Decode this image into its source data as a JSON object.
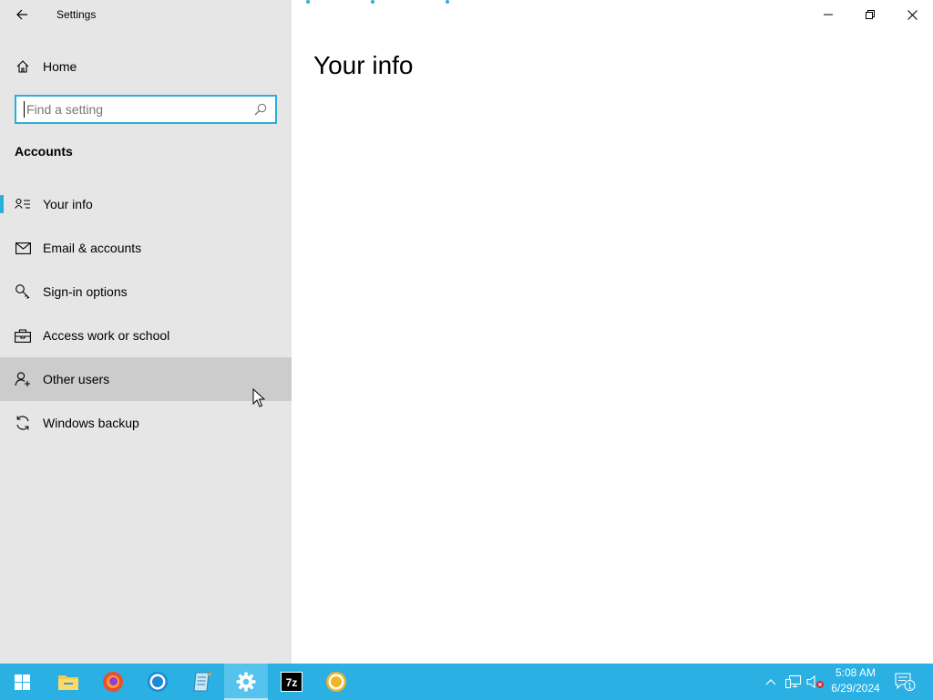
{
  "window": {
    "app_title": "Settings"
  },
  "sidebar": {
    "home_label": "Home",
    "search": {
      "placeholder": "Find a setting",
      "value": ""
    },
    "section_header": "Accounts",
    "items": [
      {
        "label": "Your info",
        "icon": "person-list-icon",
        "selected": true
      },
      {
        "label": "Email & accounts",
        "icon": "mail-icon",
        "selected": false
      },
      {
        "label": "Sign-in options",
        "icon": "key-icon",
        "selected": false
      },
      {
        "label": "Access work or school",
        "icon": "briefcase-icon",
        "selected": false
      },
      {
        "label": "Other users",
        "icon": "person-add-icon",
        "selected": false,
        "hover": true
      },
      {
        "label": "Windows backup",
        "icon": "sync-icon",
        "selected": false
      }
    ]
  },
  "main": {
    "page_title": "Your info"
  },
  "taskbar": {
    "apps": [
      "start-icon",
      "file-explorer-icon",
      "firefox-icon",
      "chrome-icon",
      "notepad-icon",
      "settings-icon",
      "7zip-icon",
      "chrome-canary-icon"
    ],
    "active_app": "settings-icon",
    "clock": {
      "time": "5:08 AM",
      "date": "6/29/2024"
    },
    "notification_count": "1"
  },
  "colors": {
    "accent": "#29b0d9",
    "taskbar": "#2ab0e3",
    "sidebar_bg": "#e6e6e6",
    "hover_bg": "#cccccc"
  }
}
